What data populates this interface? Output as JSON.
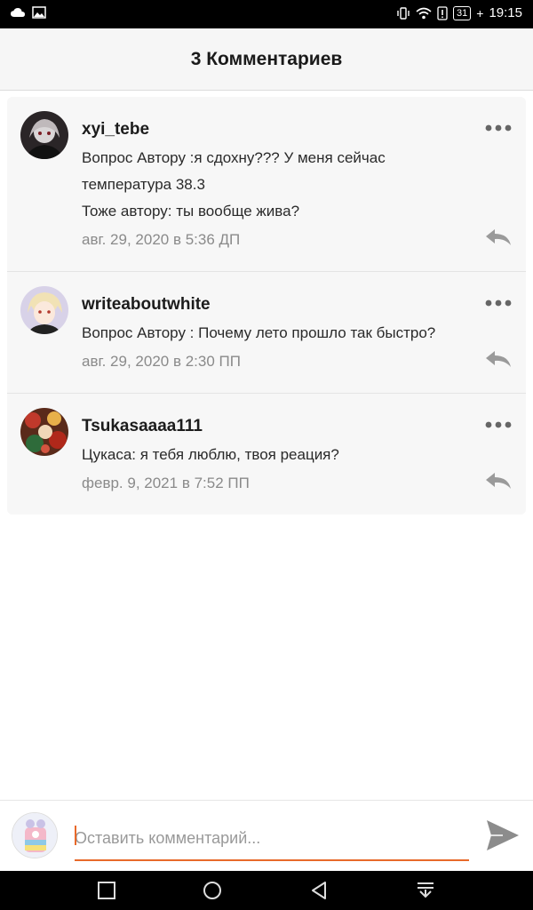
{
  "status_bar": {
    "time": "19:15",
    "battery": "31",
    "icons": [
      "cloud-icon",
      "image-icon",
      "vibrate-icon",
      "wifi-icon",
      "alert-icon",
      "battery-icon"
    ]
  },
  "header": {
    "title": "3 Комментариев"
  },
  "comments": [
    {
      "author": "xyi_tebe",
      "lines": [
        "Вопрос Автору :я  сдохну??? У меня сейчас",
        "температура 38.3",
        "Тоже автору: ты вообще жива?"
      ],
      "date": "авг. 29, 2020 в 5:36 ДП"
    },
    {
      "author": "writeaboutwhite",
      "lines": [
        "Вопрос Автору : Почему лето прошло так быстро?"
      ],
      "date": "авг. 29, 2020 в 2:30 ПП"
    },
    {
      "author": "Tsukasaaaa111",
      "lines": [
        "Цукаса: я тебя люблю, твоя реация?"
      ],
      "date": "февр. 9, 2021 в 7:52 ПП"
    }
  ],
  "composer": {
    "placeholder": "Оставить комментарий...",
    "value": ""
  },
  "colors": {
    "accent": "#e8692a",
    "date_text": "#8a8a8a",
    "card_bg": "#f7f7f7"
  }
}
